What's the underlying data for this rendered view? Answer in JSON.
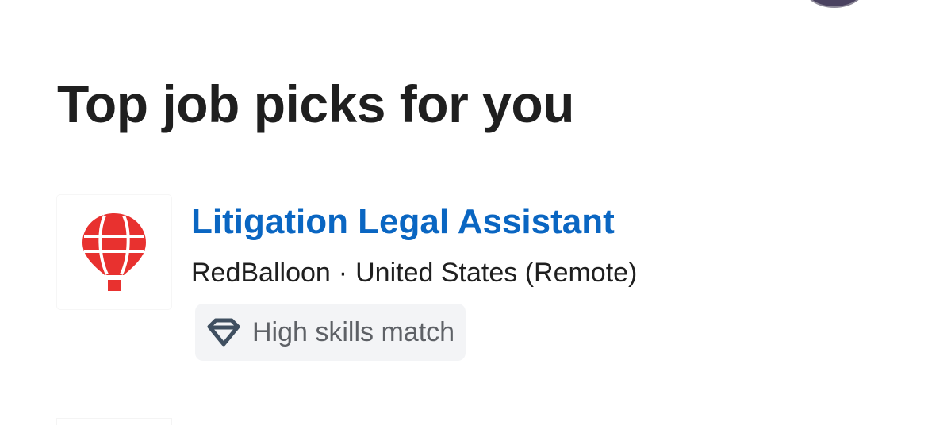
{
  "header": {
    "title": "Top job picks for you"
  },
  "job": {
    "title": "Litigation Legal Assistant",
    "company": "RedBalloon",
    "separator": "·",
    "location": "United States (Remote)",
    "badge_label": "High skills match",
    "logo_icon": "hot-air-balloon-icon",
    "badge_icon": "diamond-icon"
  },
  "colors": {
    "link": "#0a66c2",
    "title_text": "#1f1f1f",
    "badge_bg": "#f3f4f6",
    "badge_text": "#5e6166",
    "logo_red": "#e8312f"
  }
}
